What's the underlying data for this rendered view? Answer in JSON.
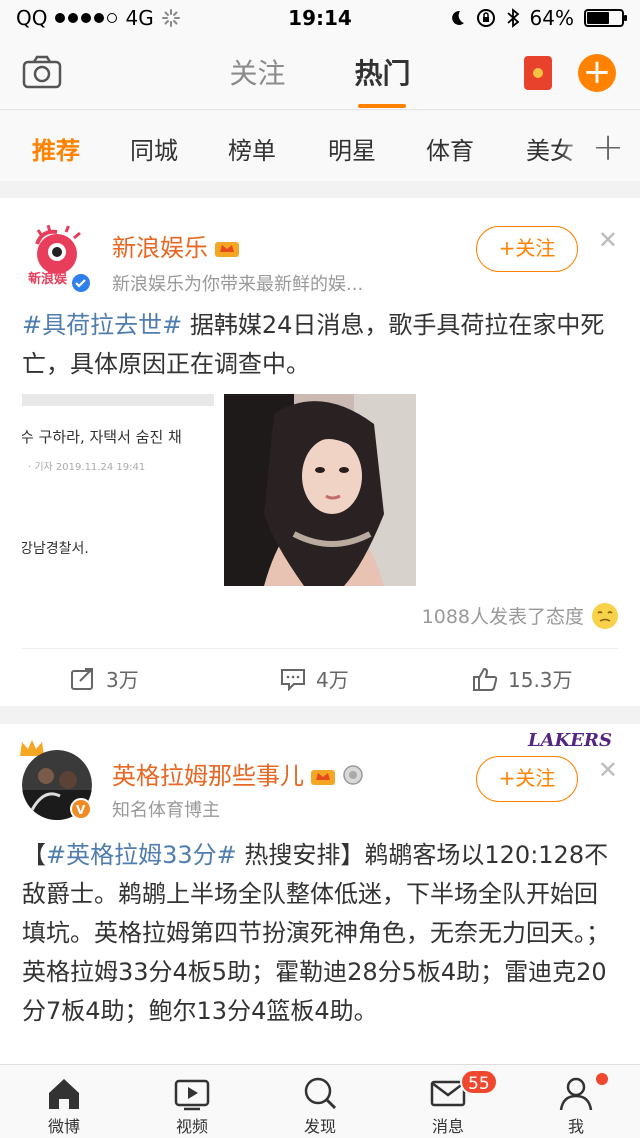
{
  "status_bar": {
    "carrier": "QQ",
    "network": "4G",
    "time": "19:14",
    "battery": "64%",
    "battery_level": 0.64
  },
  "nav": {
    "tabs": [
      {
        "label": "关注",
        "active": false
      },
      {
        "label": "热门",
        "active": true
      }
    ]
  },
  "categories": {
    "items": [
      "推荐",
      "同城",
      "榜单",
      "明星",
      "体育",
      "美女"
    ],
    "active_index": 0,
    "more": "+"
  },
  "posts": [
    {
      "user": "新浪娱乐",
      "avatar_text": "新浪娱",
      "subtitle": "新浪娱乐为你带来最新鲜的娱...",
      "follow_label": "+关注",
      "topic": "#具荷拉去世#",
      "text_after_topic": " 据韩媒24日消息，歌手具荷拉在家中死亡，具体原因正在调查中。",
      "image1_lines": [
        "수 구하라, 자택서 숨진 채",
        "· 기자 2019.11.24 19:41",
        "강남경찰서."
      ],
      "attitude": "1088人发表了态度",
      "actions": {
        "share": "3万",
        "comment": "4万",
        "like": "15.3万"
      }
    },
    {
      "user": "英格拉姆那些事儿",
      "subtitle": "知名体育博主",
      "follow_label": "+关注",
      "brand_mark": "LAKERS",
      "text_prefix": "【",
      "topic": "#英格拉姆33分#",
      "text_after_topic": " 热搜安排】鹈鹕客场以120:128不敌爵士。鹈鹕上半场全队整体低迷，下半场全队开始回填坑。英格拉姆第四节扮演死神角色，无奈无力回天。；英格拉姆33分4板5助；霍勒迪28分5板4助；雷迪克20分7板4助；鲍尔13分4篮板4助。"
    }
  ],
  "tabbar": {
    "items": [
      {
        "label": "微博",
        "icon": "home-icon"
      },
      {
        "label": "视频",
        "icon": "video-icon"
      },
      {
        "label": "发现",
        "icon": "search-icon"
      },
      {
        "label": "消息",
        "icon": "mail-icon",
        "badge": "55"
      },
      {
        "label": "我",
        "icon": "profile-icon"
      }
    ]
  },
  "colors": {
    "accent": "#ff8200",
    "username": "#e86722",
    "topic": "#507daf",
    "badge": "#f0482f"
  }
}
